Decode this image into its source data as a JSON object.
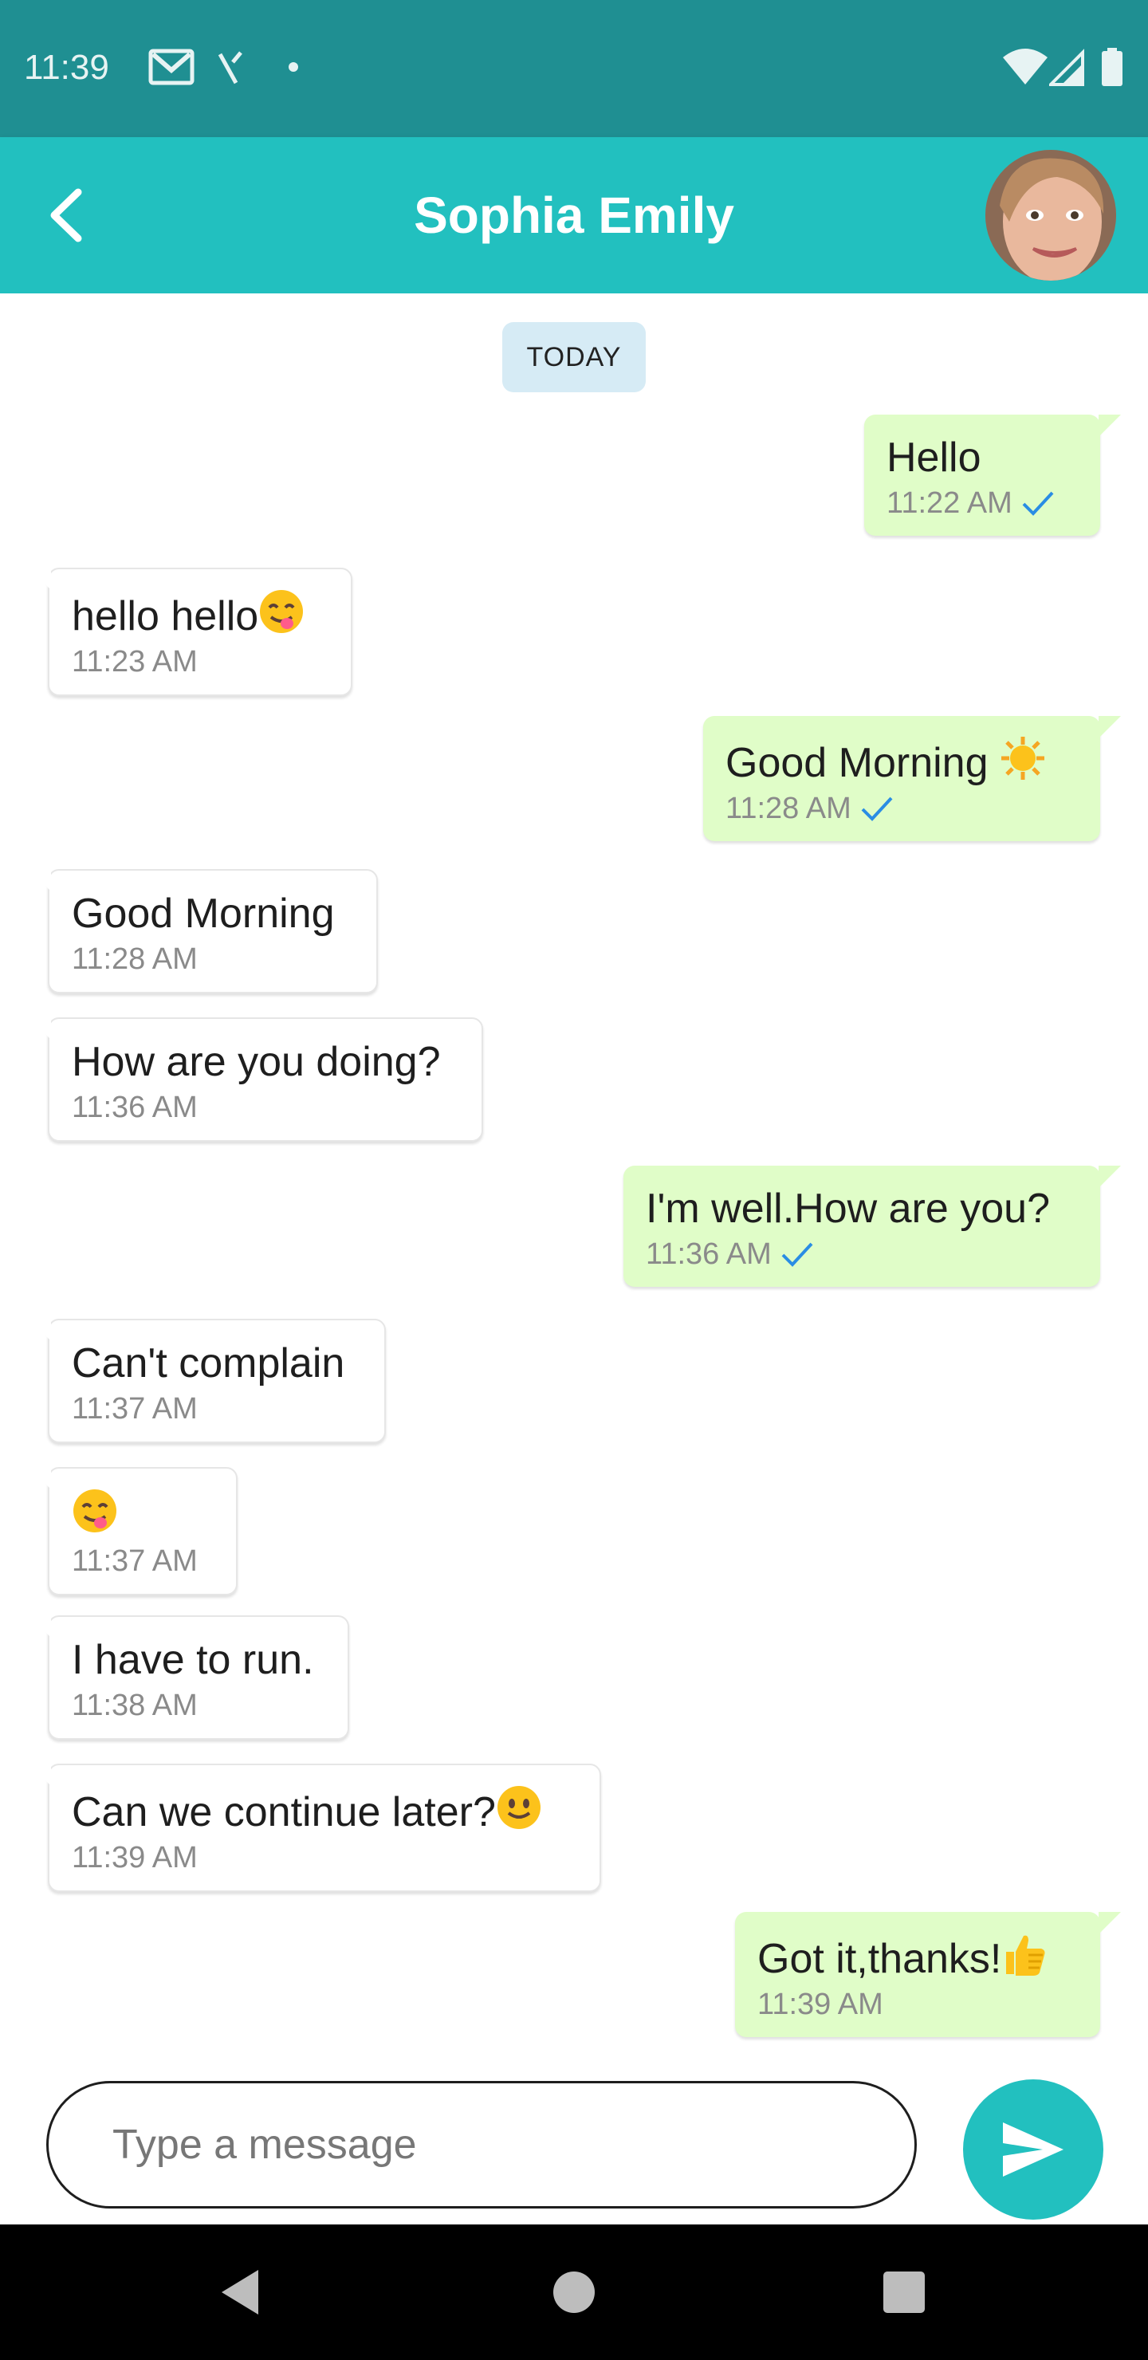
{
  "status_bar": {
    "time": "11:39",
    "icons_left": [
      "gmail-icon",
      "signal-off-icon",
      "dot-icon"
    ],
    "icons_right": [
      "wifi-icon",
      "cell-signal-icon",
      "battery-icon"
    ]
  },
  "app_bar": {
    "back_icon": "chevron-left-icon",
    "title": "Sophia Emily",
    "avatar": "contact-avatar",
    "colors": {
      "status": "#1f8f92",
      "appbar": "#22c0bf",
      "outgoing": "#e0fdc8",
      "tick": "#2a8de4"
    }
  },
  "chat": {
    "date_chip": "TODAY",
    "messages": [
      {
        "direction": "out",
        "text": "Hello",
        "time": "11:22 AM",
        "read": true
      },
      {
        "direction": "in",
        "text": "hello hello",
        "emoji": "yum-emoji",
        "time": "11:23 AM"
      },
      {
        "direction": "out",
        "text": "Good Morning ",
        "emoji": "sun-emoji",
        "time": "11:28 AM",
        "read": true
      },
      {
        "direction": "in",
        "text": "Good Morning",
        "time": "11:28 AM"
      },
      {
        "direction": "in",
        "text": "How are you doing?",
        "time": "11:36 AM"
      },
      {
        "direction": "out",
        "text": "I'm well.How are you?",
        "time": "11:36 AM",
        "read": true
      },
      {
        "direction": "in",
        "text": "Can't complain",
        "time": "11:37 AM"
      },
      {
        "direction": "in",
        "text": "",
        "emoji": "yum-emoji",
        "time": "11:37 AM"
      },
      {
        "direction": "in",
        "text": "I have to run.",
        "time": "11:38 AM"
      },
      {
        "direction": "in",
        "text": "Can we continue later?",
        "emoji": "smile-emoji",
        "time": "11:39 AM"
      },
      {
        "direction": "out",
        "text": "Got it,thanks!",
        "emoji": "thumbs-up-emoji",
        "time": "11:39 AM"
      }
    ]
  },
  "composer": {
    "placeholder": "Type a message",
    "value": "",
    "send_icon": "send-icon"
  },
  "nav_bar": {
    "buttons": [
      "back-triangle-icon",
      "home-circle-icon",
      "recents-square-icon"
    ]
  }
}
